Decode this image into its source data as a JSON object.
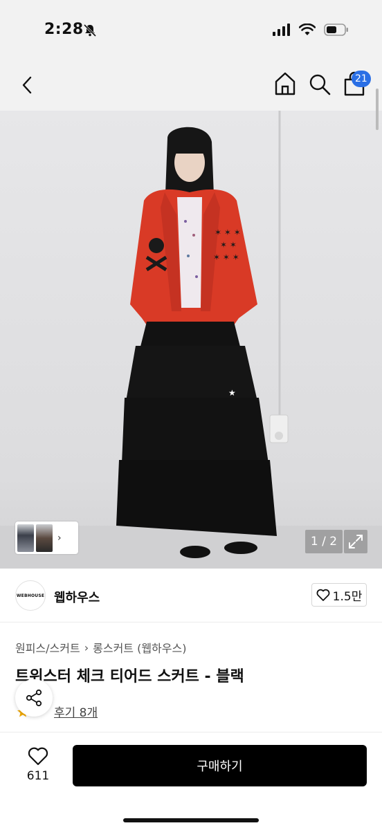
{
  "status_bar": {
    "time": "2:28"
  },
  "nav": {
    "cart_badge": "21"
  },
  "gallery": {
    "page_counter": "1 / 2"
  },
  "shop": {
    "logo_text": "WEBHOUSE",
    "name": "웹하우스",
    "like_count": "1.5만"
  },
  "product": {
    "breadcrumb": [
      "원피스/스커트",
      "롱스커트 (웹하우스)"
    ],
    "title": "트위스터 체크 티어드 스커트 - 블랙",
    "review_text": "후기 8개"
  },
  "bottom": {
    "wish_count": "611",
    "buy_label": "구매하기"
  },
  "colors": {
    "accent": "#2a6fe5",
    "buy_button": "#000000",
    "hoodie": "#d93a26",
    "skirt": "#121212"
  },
  "icons": [
    "back-icon",
    "home-icon",
    "search-icon",
    "bag-icon",
    "heart-icon",
    "share-icon",
    "expand-icon",
    "chevron-right-icon",
    "bell-off-icon",
    "signal-icon",
    "wifi-icon",
    "battery-icon"
  ]
}
